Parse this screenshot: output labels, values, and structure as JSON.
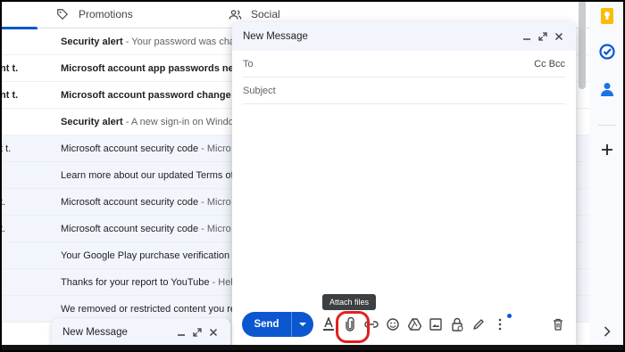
{
  "tabs": [
    {
      "label": "Promotions",
      "icon": "tag-icon"
    },
    {
      "label": "Social",
      "icon": "people-icon"
    }
  ],
  "emails": [
    {
      "sender": "",
      "subject": "Security alert",
      "snippet": " - Your password was cha",
      "unread": true
    },
    {
      "sender": "nt t.",
      "subject": "Microsoft account app passwords ne",
      "snippet": "",
      "unread": true
    },
    {
      "sender": "nt t.",
      "subject": "Microsoft account password change",
      "snippet": " -",
      "unread": true
    },
    {
      "sender": "",
      "subject": "Security alert",
      "snippet": " - A new sign-in on Windo",
      "unread": true
    },
    {
      "sender": "t t.",
      "subject": "Microsoft account security code",
      "snippet": " - Micro",
      "unread": false
    },
    {
      "sender": "",
      "subject": "Learn more about our updated Terms of",
      "snippet": "",
      "unread": false
    },
    {
      "sender": "t.",
      "subject": "Microsoft account security code",
      "snippet": " - Micro",
      "unread": false
    },
    {
      "sender": "t.",
      "subject": "Microsoft account security code",
      "snippet": " - Micro",
      "unread": false
    },
    {
      "sender": "",
      "subject": "Your Google Play purchase verification s",
      "snippet": "",
      "unread": false
    },
    {
      "sender": "",
      "subject": "Thanks for your report to YouTube",
      "snippet": " - Hell",
      "unread": false
    },
    {
      "sender": "",
      "subject": "We removed or restricted content you re",
      "snippet": "",
      "unread": false
    }
  ],
  "compose": {
    "title": "New Message",
    "to_label": "To",
    "cc_bcc": "Cc Bcc",
    "subject_placeholder": "Subject",
    "send_label": "Send"
  },
  "tooltip": "Attach files",
  "minimized": {
    "title": "New Message"
  },
  "colors": {
    "accent": "#0b57d0",
    "highlight": "#e02020"
  }
}
